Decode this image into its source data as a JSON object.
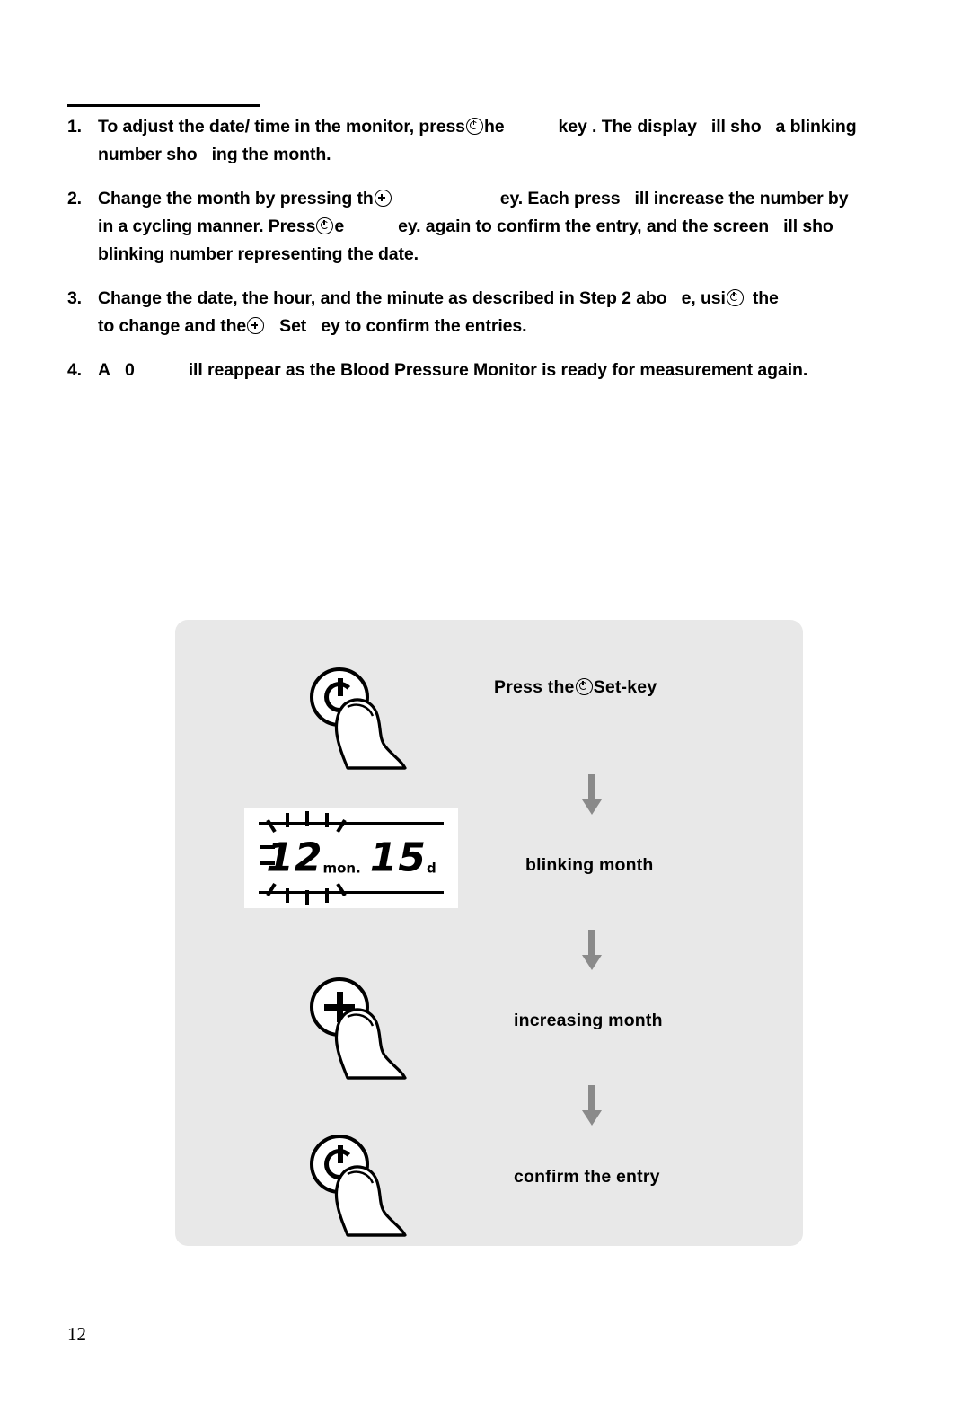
{
  "document": {
    "page_number": "12"
  },
  "steps": [
    {
      "number": "1.",
      "segments": [
        {
          "type": "text",
          "value": "To adjust the date/ time in the monitor, press"
        },
        {
          "type": "icon",
          "value": "set-key-icon"
        },
        {
          "type": "text",
          "value": "the"
        },
        {
          "type": "text",
          "value": "key . The display"
        },
        {
          "type": "text",
          "value": "ill sho"
        },
        {
          "type": "text",
          "value": "a blinking"
        },
        {
          "type": "text",
          "value": "number sho"
        },
        {
          "type": "text",
          "value": "ing the month."
        }
      ]
    },
    {
      "number": "2.",
      "segments": [
        {
          "type": "text",
          "value": "Change the month by pressing th"
        },
        {
          "type": "icon",
          "value": "plus-key-icon"
        },
        {
          "type": "text",
          "value": "ey. Each press"
        },
        {
          "type": "text",
          "value": "ill increase the number by"
        },
        {
          "type": "text",
          "value": "in a cycling manner. Press"
        },
        {
          "type": "icon",
          "value": "set-key-icon"
        },
        {
          "type": "text",
          "value": "e"
        },
        {
          "type": "text",
          "value": "ey. again to confirm the entry, and the screen"
        },
        {
          "type": "text",
          "value": "ill sho"
        },
        {
          "type": "text",
          "value": "blinking number representing the date."
        }
      ]
    },
    {
      "number": "3.",
      "segments": [
        {
          "type": "text",
          "value": "Change the date, the hour, and the minute as described in Step 2 abo"
        },
        {
          "type": "text",
          "value": "e, usi"
        },
        {
          "type": "icon",
          "value": "set-key-icon"
        },
        {
          "type": "text",
          "value": "the"
        },
        {
          "type": "text",
          "value": "to change and the"
        },
        {
          "type": "icon",
          "value": "plus-key-icon"
        },
        {
          "type": "text",
          "value": "Set"
        },
        {
          "type": "text",
          "value": "ey  to confirm the entries."
        }
      ]
    },
    {
      "number": "4.",
      "segments": [
        {
          "type": "text",
          "value": "A"
        },
        {
          "type": "text",
          "value": "0"
        },
        {
          "type": "text",
          "value": "ill reappear as the Blood Pressure Monitor is ready for measurement again."
        }
      ]
    }
  ],
  "step_text": {
    "s1_a": "To adjust the date/ time in the monitor, press",
    "s1_b": "he",
    "s1_c": "key . The display",
    "s1_d": "ill sho",
    "s1_e": "a blinking",
    "s1_f": "number sho",
    "s1_g": "ing the month.",
    "s2_a": "Change the month by pressing th",
    "s2_b": "ey. Each press",
    "s2_c": "ill increase the number by",
    "s2_d": "in a cycling manner. Press",
    "s2_e": "e",
    "s2_f": "ey. again to confirm the entry, and the screen",
    "s2_g": "ill sho",
    "s2_h": "blinking number representing the date.",
    "s3_a": "Change the date, the hour, and the minute as described in Step 2 abo",
    "s3_b": "e, usi",
    "s3_c": "the",
    "s3_d": "to change and the",
    "s3_e": "Set",
    "s3_f": "ey  to confirm the entries.",
    "s4_a": "A",
    "s4_b": "0",
    "s4_c": "ill reappear as the Blood Pressure Monitor is ready for measurement again."
  },
  "figure": {
    "captions": {
      "press_set_a": "Press  the",
      "press_set_b": "Set-key",
      "blinking_month": "blinking month",
      "increasing_month": "increasing month",
      "confirm_entry": "confirm the entry"
    },
    "lcd": {
      "month_value": "12",
      "month_unit": "mon.",
      "day_value": "15",
      "day_unit": "d"
    }
  }
}
